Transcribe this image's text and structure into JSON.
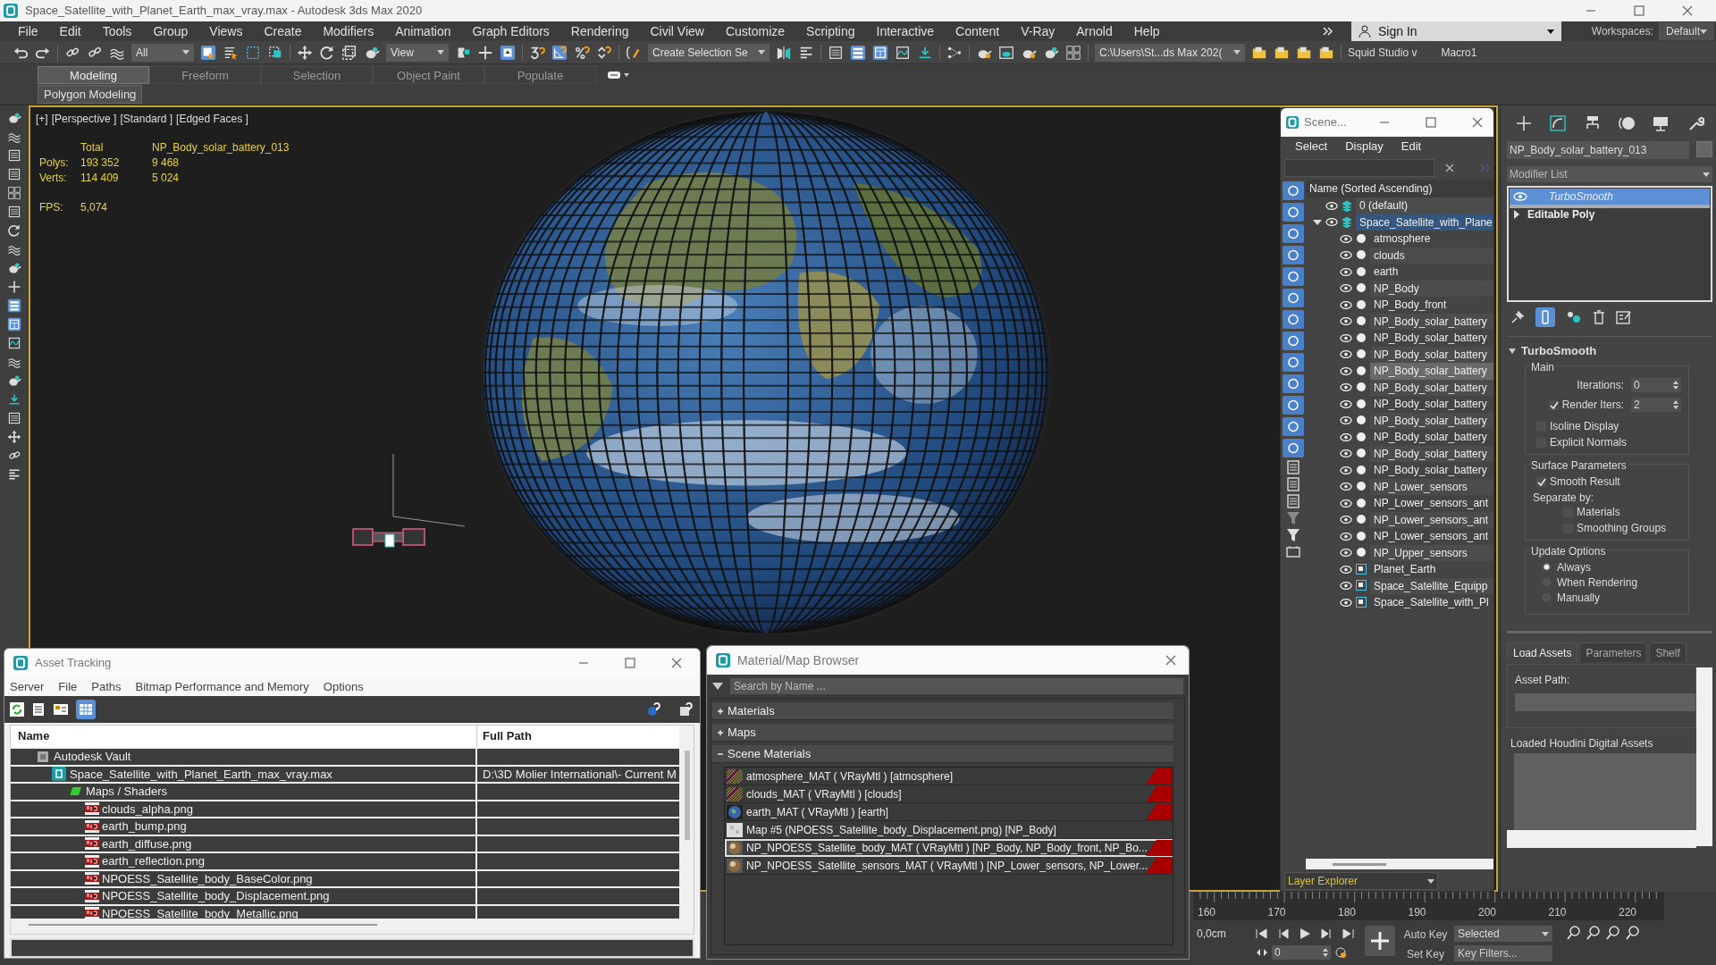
{
  "window": {
    "title": "Space_Satellite_with_Planet_Earth_max_vray.max - Autodesk 3ds Max 2020"
  },
  "menu": [
    "File",
    "Edit",
    "Tools",
    "Group",
    "Views",
    "Create",
    "Modifiers",
    "Animation",
    "Graph Editors",
    "Rendering",
    "Civil View",
    "Customize",
    "Scripting",
    "Interactive",
    "Content",
    "V-Ray",
    "Arnold",
    "Help"
  ],
  "account": {
    "sign_in": "Sign In",
    "workspaces_label": "Workspaces:",
    "workspace": "Default"
  },
  "toolbar": {
    "selection_filter": "All",
    "reference_coordinates": "View",
    "named_selection": "Create Selection Se",
    "project_path": "C:\\Users\\St...ds Max 202(",
    "scripts": [
      "Squid Studio v",
      "Macro1"
    ]
  },
  "ribbon": {
    "tabs": [
      {
        "label": "Modeling",
        "selected": true
      },
      {
        "label": "Freeform",
        "selected": false
      },
      {
        "label": "Selection",
        "selected": false
      },
      {
        "label": "Object Paint",
        "selected": false
      },
      {
        "label": "Populate",
        "selected": false
      }
    ],
    "panel": "Polygon Modeling"
  },
  "viewport": {
    "labels": [
      "[+]",
      "[Perspective ]",
      "[Standard ]",
      "[Edged Faces ]"
    ],
    "stats": {
      "headers": [
        "Total",
        "NP_Body_solar_battery_013"
      ],
      "rows": [
        {
          "label": "Polys:",
          "total": "193 352",
          "selected": "9 468"
        },
        {
          "label": "Verts:",
          "total": "114 409",
          "selected": "5 024"
        }
      ],
      "fps_label": "FPS:",
      "fps": "5,074"
    }
  },
  "scene_explorer": {
    "title": "Scene...",
    "menu": [
      "Select",
      "Display",
      "Edit"
    ],
    "column": "Name (Sorted Ascending)",
    "tree": [
      {
        "label": "0 (default)",
        "kind": "layer",
        "selected": false
      },
      {
        "label": "Space_Satellite_with_Plane",
        "kind": "layer",
        "selected": true,
        "expanded": true,
        "children": [
          {
            "label": "atmosphere",
            "kind": "object",
            "selected": false
          },
          {
            "label": "clouds",
            "kind": "object",
            "selected": false
          },
          {
            "label": "earth",
            "kind": "object",
            "selected": false
          },
          {
            "label": "NP_Body",
            "kind": "object",
            "selected": false
          },
          {
            "label": "NP_Body_front",
            "kind": "object",
            "selected": false
          },
          {
            "label": "NP_Body_solar_battery",
            "kind": "object",
            "selected": false
          },
          {
            "label": "NP_Body_solar_battery",
            "kind": "object",
            "selected": false
          },
          {
            "label": "NP_Body_solar_battery",
            "kind": "object",
            "selected": false
          },
          {
            "label": "NP_Body_solar_battery",
            "kind": "object",
            "selected": true
          },
          {
            "label": "NP_Body_solar_battery",
            "kind": "object",
            "selected": false
          },
          {
            "label": "NP_Body_solar_battery",
            "kind": "object",
            "selected": false
          },
          {
            "label": "NP_Body_solar_battery",
            "kind": "object",
            "selected": false
          },
          {
            "label": "NP_Body_solar_battery",
            "kind": "object",
            "selected": false
          },
          {
            "label": "NP_Body_solar_battery",
            "kind": "object",
            "selected": false
          },
          {
            "label": "NP_Body_solar_battery",
            "kind": "object",
            "selected": false
          },
          {
            "label": "NP_Lower_sensors",
            "kind": "object",
            "selected": false
          },
          {
            "label": "NP_Lower_sensors_ant",
            "kind": "object",
            "selected": false
          },
          {
            "label": "NP_Lower_sensors_ant",
            "kind": "object",
            "selected": false
          },
          {
            "label": "NP_Lower_sensors_ant",
            "kind": "object",
            "selected": false
          },
          {
            "label": "NP_Upper_sensors",
            "kind": "object",
            "selected": false
          },
          {
            "label": "Planet_Earth",
            "kind": "group",
            "selected": false
          },
          {
            "label": "Space_Satellite_Equipp",
            "kind": "group",
            "selected": false
          },
          {
            "label": "Space_Satellite_with_Pl",
            "kind": "group",
            "selected": false
          }
        ]
      }
    ],
    "footer": "Layer Explorer"
  },
  "command_panel": {
    "object_name": "NP_Body_solar_battery_013",
    "modifier_list": "Modifier List",
    "stack": [
      {
        "label": "TurboSmooth",
        "selected": true
      },
      {
        "label": "Editable Poly",
        "selected": false,
        "expanded": false
      }
    ],
    "rollout": {
      "title": "TurboSmooth",
      "main": {
        "title": "Main",
        "iterations_label": "Iterations:",
        "iterations": "0",
        "render_iters_label": "Render Iters:",
        "render_iters": "2",
        "render_iters_checked": true,
        "options": [
          {
            "label": "Isoline Display",
            "checked": false
          },
          {
            "label": "Explicit Normals",
            "checked": false
          }
        ]
      },
      "surface": {
        "title": "Surface Parameters",
        "smooth_result": {
          "label": "Smooth Result",
          "checked": true
        },
        "separate_label": "Separate by:",
        "separate": [
          {
            "label": "Materials",
            "checked": false
          },
          {
            "label": "Smoothing Groups",
            "checked": false
          }
        ]
      },
      "update": {
        "title": "Update Options",
        "options": [
          {
            "label": "Always",
            "selected": true
          },
          {
            "label": "When Rendering",
            "selected": false
          },
          {
            "label": "Manually",
            "selected": false
          }
        ]
      }
    }
  },
  "houdini": {
    "tabs": [
      {
        "label": "Load Assets",
        "selected": true
      },
      {
        "label": "Parameters",
        "selected": false
      },
      {
        "label": "Shelf",
        "selected": false
      }
    ],
    "asset_path_label": "Asset Path:",
    "loaded_label": "Loaded Houdini Digital Assets"
  },
  "asset_tracking": {
    "title": "Asset Tracking",
    "menu": [
      "Server",
      "File",
      "Paths",
      "Bitmap Performance and Memory",
      "Options"
    ],
    "columns": [
      "Name",
      "Full Path"
    ],
    "tree": [
      {
        "name": "Autodesk Vault",
        "kind": "vault",
        "children": [
          {
            "name": "Space_Satellite_with_Planet_Earth_max_vray.max",
            "path": "D:\\3D Molier International\\- Current M",
            "kind": "scene",
            "children": [
              {
                "name": "Maps / Shaders",
                "kind": "folder",
                "children": [
                  {
                    "name": "clouds_alpha.png",
                    "kind": "png"
                  },
                  {
                    "name": "earth_bump.png",
                    "kind": "png"
                  },
                  {
                    "name": "earth_diffuse.png",
                    "kind": "png"
                  },
                  {
                    "name": "earth_reflection.png",
                    "kind": "png"
                  },
                  {
                    "name": "NPOESS_Satellite_body_BaseColor.png",
                    "kind": "png"
                  },
                  {
                    "name": "NPOESS_Satellite_body_Displacement.png",
                    "kind": "png"
                  },
                  {
                    "name": "NPOESS_Satellite_body_Metallic.png",
                    "kind": "png"
                  }
                ]
              }
            ]
          }
        ]
      }
    ]
  },
  "material_browser": {
    "title": "Material/Map Browser",
    "search_placeholder": "Search by Name ...",
    "groups": [
      {
        "label": "Materials",
        "expanded": false
      },
      {
        "label": "Maps",
        "expanded": false
      },
      {
        "label": "Scene Materials",
        "expanded": true,
        "items": [
          {
            "label": "atmosphere_MAT ( VRayMtl ) [atmosphere]",
            "kind": "checker",
            "flagged": true,
            "selected": false
          },
          {
            "label": "clouds_MAT ( VRayMtl ) [clouds]",
            "kind": "checker",
            "flagged": true,
            "selected": false
          },
          {
            "label": "earth_MAT ( VRayMtl ) [earth]",
            "kind": "globe",
            "flagged": true,
            "selected": false
          },
          {
            "label": "Map #5 (NPOESS_Satellite_body_Displacement.png) [NP_Body]",
            "kind": "map",
            "flagged": false,
            "selected": false
          },
          {
            "label": "NP_NPOESS_Satellite_body_MAT ( VRayMtl ) [NP_Body, NP_Body_front, NP_Bo...",
            "kind": "sphere",
            "flagged": true,
            "selected": true
          },
          {
            "label": "NP_NPOESS_Satellite_sensors_MAT ( VRayMtl ) [NP_Lower_sensors, NP_Lower...",
            "kind": "sphere",
            "flagged": true,
            "selected": false
          }
        ]
      }
    ]
  },
  "timeline": {
    "ticks": [
      "160",
      "170",
      "180",
      "190",
      "200",
      "210",
      "220"
    ],
    "coordinate": "0,0cm",
    "auto_key": "Auto Key",
    "key_mode": "Selected",
    "set_key": "Set Key",
    "key_filters": "Key Filters...",
    "frame": "0"
  }
}
